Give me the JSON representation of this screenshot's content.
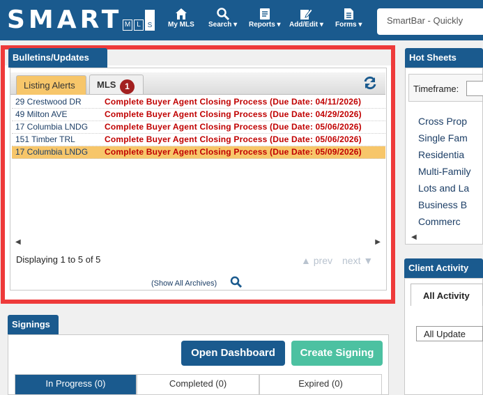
{
  "header": {
    "logo_text": "SMART",
    "logo_sub": [
      "M",
      "L",
      "S"
    ],
    "nav": [
      {
        "icon": "home-icon",
        "label": "My MLS"
      },
      {
        "icon": "search-icon",
        "label": "Search ▾"
      },
      {
        "icon": "reports-icon",
        "label": "Reports ▾"
      },
      {
        "icon": "edit-icon",
        "label": "Add/Edit ▾"
      },
      {
        "icon": "forms-icon",
        "label": "Forms ▾"
      }
    ],
    "smartbar_placeholder": "SmartBar - Quickly"
  },
  "bulletins": {
    "title": "Bulletins/Updates",
    "tabs": [
      {
        "label": "Listing Alerts",
        "active": true
      },
      {
        "label": "MLS",
        "active": false,
        "badge": "1"
      }
    ],
    "rows": [
      {
        "address": "29 Crestwood DR",
        "message": "Complete Buyer Agent Closing Process (Due Date: 04/11/2026)"
      },
      {
        "address": "49 Milton AVE",
        "message": "Complete Buyer Agent Closing Process (Due Date: 04/29/2026)"
      },
      {
        "address": "17 Columbia LNDG",
        "message": "Complete Buyer Agent Closing Process (Due Date: 05/06/2026)"
      },
      {
        "address": "151 Timber TRL",
        "message": "Complete Buyer Agent Closing Process (Due Date: 05/06/2026)"
      },
      {
        "address": "17 Columbia LNDG",
        "message": "Complete Buyer Agent Closing Process (Due Date: 05/09/2026)"
      }
    ],
    "selected_row": 4,
    "display_text": "Displaying 1 to 5 of 5",
    "prev_label": "▲ prev",
    "next_label": "next ▼",
    "archives_link": "(Show All Archives)"
  },
  "signings": {
    "title": "Signings",
    "open_dashboard": "Open Dashboard",
    "create_signing": "Create Signing",
    "tabs": [
      "In Progress (0)",
      "Completed (0)",
      "Expired (0)"
    ]
  },
  "hot_sheets": {
    "title": "Hot Sheets",
    "timeframe_label": "Timeframe:",
    "links": [
      "Cross Prop",
      "Single Fam",
      "Residentia",
      "Multi-Family",
      "Lots and La",
      "Business B",
      "Commerc"
    ]
  },
  "client_activity": {
    "title": "Client Activity",
    "tab": "All Activity",
    "select_value": "All Update"
  },
  "colors": {
    "brand_blue": "#1a5a8e",
    "alert_red": "#c00000",
    "highlight": "#f7c66a",
    "frame_red": "#ee3a3a",
    "teal": "#4cc1a1"
  }
}
